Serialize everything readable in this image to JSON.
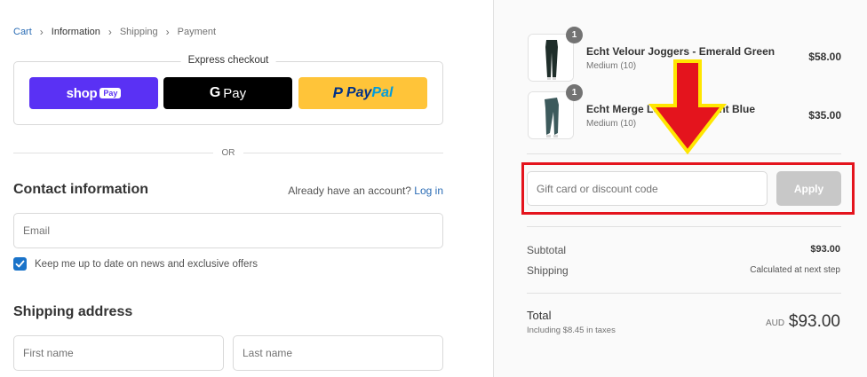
{
  "breadcrumb": {
    "items": [
      {
        "label": "Cart",
        "state": "link"
      },
      {
        "label": "Information",
        "state": "current"
      },
      {
        "label": "Shipping",
        "state": "upcoming"
      },
      {
        "label": "Payment",
        "state": "upcoming"
      }
    ]
  },
  "express_checkout": {
    "title": "Express checkout",
    "shop_pay": {
      "word": "shop",
      "chip": "Pay"
    },
    "google_pay": {
      "g": "G",
      "word": "Pay"
    },
    "paypal": {
      "mark": "P",
      "word_a": "Pay",
      "word_b": "Pal"
    }
  },
  "or_label": "OR",
  "contact": {
    "title": "Contact information",
    "account_prompt": "Already have an account?",
    "login_link": "Log in",
    "email_placeholder": "Email",
    "newsletter_label": "Keep me up to date on news and exclusive offers",
    "newsletter_checked": true
  },
  "shipping": {
    "title": "Shipping address",
    "first_name_placeholder": "First name",
    "last_name_placeholder": "Last name"
  },
  "order": {
    "items": [
      {
        "name": "Echt Velour Joggers - Emerald Green",
        "variant": "Medium (10)",
        "price": "$58.00",
        "quantity": "1"
      },
      {
        "name": "Echt Merge Leggings - Faint Blue",
        "variant": "Medium (10)",
        "price": "$35.00",
        "quantity": "1"
      }
    ],
    "discount_placeholder": "Gift card or discount code",
    "apply_label": "Apply",
    "subtotal_label": "Subtotal",
    "subtotal_value": "$93.00",
    "shipping_label": "Shipping",
    "shipping_value": "Calculated at next step",
    "total_label": "Total",
    "tax_note": "Including $8.45 in taxes",
    "currency": "AUD",
    "total_value": "$93.00"
  },
  "colors": {
    "link": "#2a6cb5",
    "shop_pay": "#5a31f4",
    "paypal_yellow": "#ffc439",
    "annotation_red": "#e4141d",
    "annotation_yellow": "#ffe600",
    "checkbox_blue": "#1a73c9"
  }
}
